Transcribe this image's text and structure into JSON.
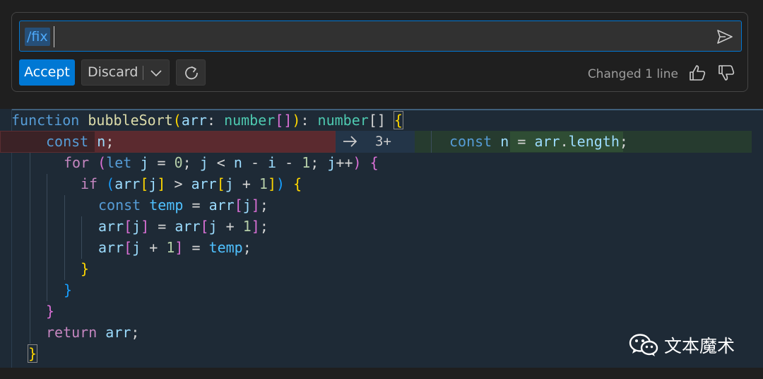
{
  "chat": {
    "slash_command": "/fix",
    "input_value": "",
    "accept_label": "Accept",
    "discard_label": "Discard",
    "status": "Changed 1 line",
    "icons": {
      "send": "send-icon",
      "dropdown": "chevron-down-icon",
      "rerun": "refresh-icon",
      "thumbs_up": "thumbs-up-icon",
      "thumbs_down": "thumbs-down-icon"
    },
    "accent_color": "#0078d4"
  },
  "editor": {
    "line1": {
      "kw": "function",
      "name": "bubbleSort",
      "p1": "(",
      "param": "arr",
      "colon": ": ",
      "type1": "number",
      "br1": "[]",
      "p2": ")",
      "colon2": ": ",
      "type2": "number",
      "br2": "[] ",
      "brace": "{"
    },
    "diff": {
      "removed": {
        "kw": "const",
        "name": "n",
        "semi": ";"
      },
      "arrow_icon": "arrow-right-icon",
      "change_count": "3+",
      "added": {
        "kw": "const",
        "name": "n",
        "eq": " = ",
        "obj": "arr",
        "dot": ".",
        "prop": "length",
        "semi": ";"
      }
    },
    "line3": {
      "kw": "for",
      "sp": " ",
      "p1": "(",
      "let": "let",
      "j": " j",
      "eq": " = ",
      "zero": "0",
      "semi1": "; ",
      "j2": "j",
      "lt": " < ",
      "n": "n",
      "minus1": " - ",
      "i": "i",
      "minus2": " - ",
      "one": "1",
      "semi2": "; ",
      "j3": "j",
      "inc": "++",
      "p2": ")",
      "brace": " {"
    },
    "line4": {
      "kw": "if",
      "sp": " ",
      "p1": "(",
      "arr1": "arr",
      "b1": "[",
      "j1": "j",
      "b2": "]",
      "gt": " > ",
      "arr2": "arr",
      "b3": "[",
      "j2": "j",
      "plus": " + ",
      "one": "1",
      "b4": "]",
      "p2": ")",
      "brace": " {"
    },
    "line5": {
      "kw": "const",
      "sp": " ",
      "name": "temp",
      "eq": " = ",
      "arr": "arr",
      "b1": "[",
      "j": "j",
      "b2": "]",
      "semi": ";"
    },
    "line6": {
      "arr1": "arr",
      "b1": "[",
      "j1": "j",
      "b2": "]",
      "eq": " = ",
      "arr2": "arr",
      "b3": "[",
      "j2": "j",
      "plus": " + ",
      "one": "1",
      "b4": "]",
      "semi": ";"
    },
    "line7": {
      "arr": "arr",
      "b1": "[",
      "j": "j",
      "plus": " + ",
      "one": "1",
      "b2": "]",
      "eq": " = ",
      "temp": "temp",
      "semi": ";"
    },
    "line8": {
      "brace": "}"
    },
    "line9": {
      "brace": "}"
    },
    "line10": {
      "brace": "}"
    },
    "line11": {
      "kw": "return",
      "sp": " ",
      "arr": "arr",
      "semi": ";"
    },
    "line12": {
      "brace": "}"
    }
  },
  "watermark": {
    "icon": "wechat-icon",
    "text": "文本魔术"
  }
}
